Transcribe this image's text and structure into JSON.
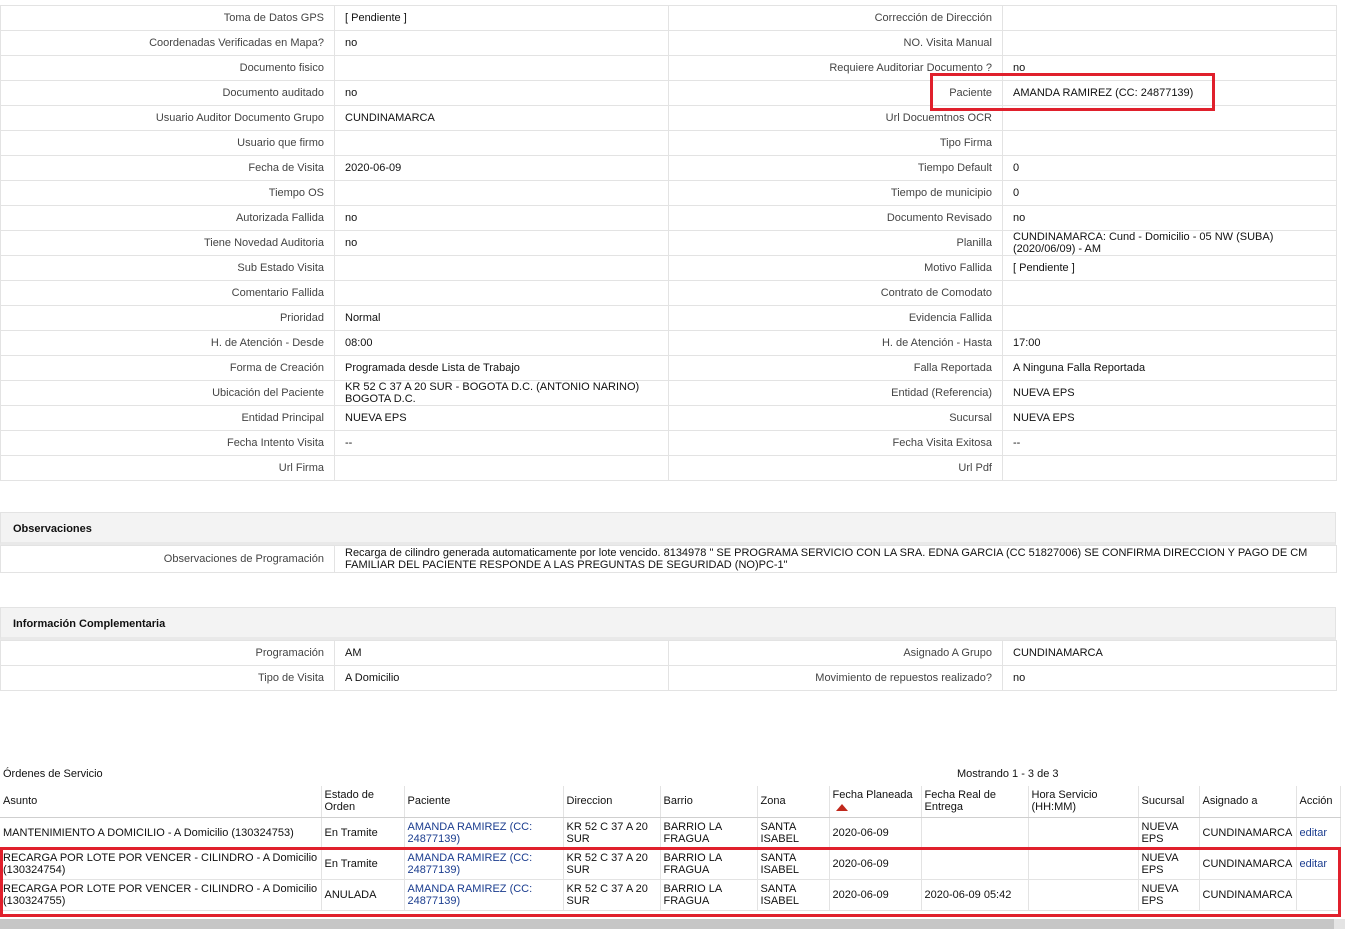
{
  "detail_rows": [
    {
      "l1": "Toma de Datos GPS",
      "v1": "[ Pendiente ]",
      "l2": "Corrección de Dirección",
      "v2": ""
    },
    {
      "l1": "Coordenadas Verificadas en Mapa?",
      "v1": " no",
      "l2": "NO. Visita Manual",
      "v2": ""
    },
    {
      "l1": "Documento fisico",
      "v1": "",
      "l2": "Requiere Auditoriar Documento ?",
      "v2": " no"
    },
    {
      "l1": "Documento auditado",
      "v1": " no",
      "l2": "Paciente",
      "v2": "AMANDA RAMIREZ (CC: 24877139)"
    },
    {
      "l1": "Usuario Auditor Documento Grupo",
      "v1": "CUNDINAMARCA",
      "l2": "Url Docuemtnos OCR",
      "v2": ""
    },
    {
      "l1": "Usuario que firmo",
      "v1": "",
      "l2": "Tipo Firma",
      "v2": ""
    },
    {
      "l1": "Fecha de Visita",
      "v1": " 2020-06-09",
      "l2": "Tiempo Default",
      "v2": "0"
    },
    {
      "l1": "Tiempo OS",
      "v1": "",
      "l2": "Tiempo de municipio",
      "v2": "0"
    },
    {
      "l1": "Autorizada Fallida",
      "v1": " no",
      "l2": "Documento Revisado",
      "v2": " no"
    },
    {
      "l1": "Tiene Novedad Auditoria",
      "v1": " no",
      "l2": "Planilla",
      "v2": "CUNDINAMARCA: Cund - Domicilio - 05 NW (SUBA) (2020/06/09) - AM"
    },
    {
      "l1": "Sub Estado Visita",
      "v1": "",
      "l2": "Motivo Fallida",
      "v2": "[ Pendiente ]"
    },
    {
      "l1": "Comentario Fallida",
      "v1": "",
      "l2": "Contrato de Comodato",
      "v2": ""
    },
    {
      "l1": "Prioridad",
      "v1": "Normal",
      "l2": "Evidencia Fallida",
      "v2": ""
    },
    {
      "l1": "H. de Atención - Desde",
      "v1": "08:00",
      "l2": "H. de Atención - Hasta",
      "v2": "17:00"
    },
    {
      "l1": "Forma de Creación",
      "v1": "Programada desde Lista de Trabajo",
      "l2": "Falla Reportada",
      "v2": "A Ninguna Falla Reportada"
    },
    {
      "l1": "Ubicación del Paciente",
      "v1": "KR 52 C 37 A 20 SUR - BOGOTA D.C. (ANTONIO NARINO) BOGOTA D.C.",
      "l2": "Entidad (Referencia)",
      "v2": "NUEVA EPS"
    },
    {
      "l1": "Entidad Principal",
      "v1": "NUEVA EPS",
      "l2": "Sucursal",
      "v2": "NUEVA EPS"
    },
    {
      "l1": "Fecha Intento Visita",
      "v1": " --",
      "l2": "Fecha Visita Exitosa",
      "v2": " --"
    },
    {
      "l1": "Url Firma",
      "v1": "",
      "l2": "Url Pdf",
      "v2": ""
    }
  ],
  "observaciones": {
    "title": "Observaciones",
    "label": "Observaciones de Programación",
    "value": "  Recarga de cilindro generada automaticamente por lote vencido. 8134978 \" SE PROGRAMA SERVICIO CON LA SRA. EDNA GARCIA (CC 51827006) SE CONFIRMA DIRECCION Y PAGO DE CM FAMILIAR DEL PACIENTE RESPONDE A LAS PREGUNTAS DE SEGURIDAD (NO)PC-1\""
  },
  "complementaria": {
    "title": "Información Complementaria",
    "rows": [
      {
        "l1": "Programación",
        "v1": "AM",
        "l2": "Asignado A Grupo",
        "v2": "CUNDINAMARCA"
      },
      {
        "l1": "Tipo de Visita",
        "v1": "A Domicilio",
        "l2": "Movimiento de repuestos realizado?",
        "v2": " no"
      }
    ]
  },
  "orders": {
    "title": "Órdenes de Servicio",
    "count": "Mostrando 1 - 3 de 3",
    "headers": [
      "Asunto",
      "Estado de Orden",
      "Paciente",
      "Direccion",
      "Barrio",
      "Zona",
      "Fecha Planeada",
      "Fecha Real de Entrega",
      "Hora Servicio (HH:MM)",
      "Sucursal",
      "Asignado a",
      "Acción"
    ],
    "rows": [
      {
        "asunto": "MANTENIMIENTO A DOMICILIO - A Domicilio (130324753)",
        "estado": "En Tramite",
        "paciente": "AMANDA RAMIREZ (CC: 24877139)",
        "direccion": "KR 52 C 37 A 20 SUR",
        "barrio": "BARRIO LA FRAGUA",
        "zona": "SANTA ISABEL",
        "fecha_planeada": "2020-06-09",
        "fecha_real": "",
        "hora": "",
        "sucursal": "NUEVA EPS",
        "asignado": "CUNDINAMARCA",
        "accion": "editar"
      },
      {
        "asunto": "RECARGA POR LOTE POR VENCER - CILINDRO - A Domicilio (130324754)",
        "estado": "En Tramite",
        "paciente": "AMANDA RAMIREZ (CC: 24877139)",
        "direccion": "KR 52 C 37 A 20 SUR",
        "barrio": "BARRIO LA FRAGUA",
        "zona": "SANTA ISABEL",
        "fecha_planeada": "2020-06-09",
        "fecha_real": "",
        "hora": "",
        "sucursal": "NUEVA EPS",
        "asignado": "CUNDINAMARCA",
        "accion": "editar"
      },
      {
        "asunto": "RECARGA POR LOTE POR VENCER - CILINDRO - A Domicilio (130324755)",
        "estado": "ANULADA",
        "paciente": "AMANDA RAMIREZ (CC: 24877139)",
        "direccion": "KR 52 C 37 A 20 SUR",
        "barrio": "BARRIO LA FRAGUA",
        "zona": "SANTA ISABEL",
        "fecha_planeada": "2020-06-09",
        "fecha_real": "2020-06-09 05:42",
        "hora": "",
        "sucursal": "NUEVA EPS",
        "asignado": "CUNDINAMARCA",
        "accion": ""
      }
    ]
  },
  "colors": {
    "highlight": "#e0202c",
    "link": "#1b3d8f",
    "sort_indicator": "#c0281c"
  },
  "icons": {
    "sort": "sort-ascending-icon"
  }
}
